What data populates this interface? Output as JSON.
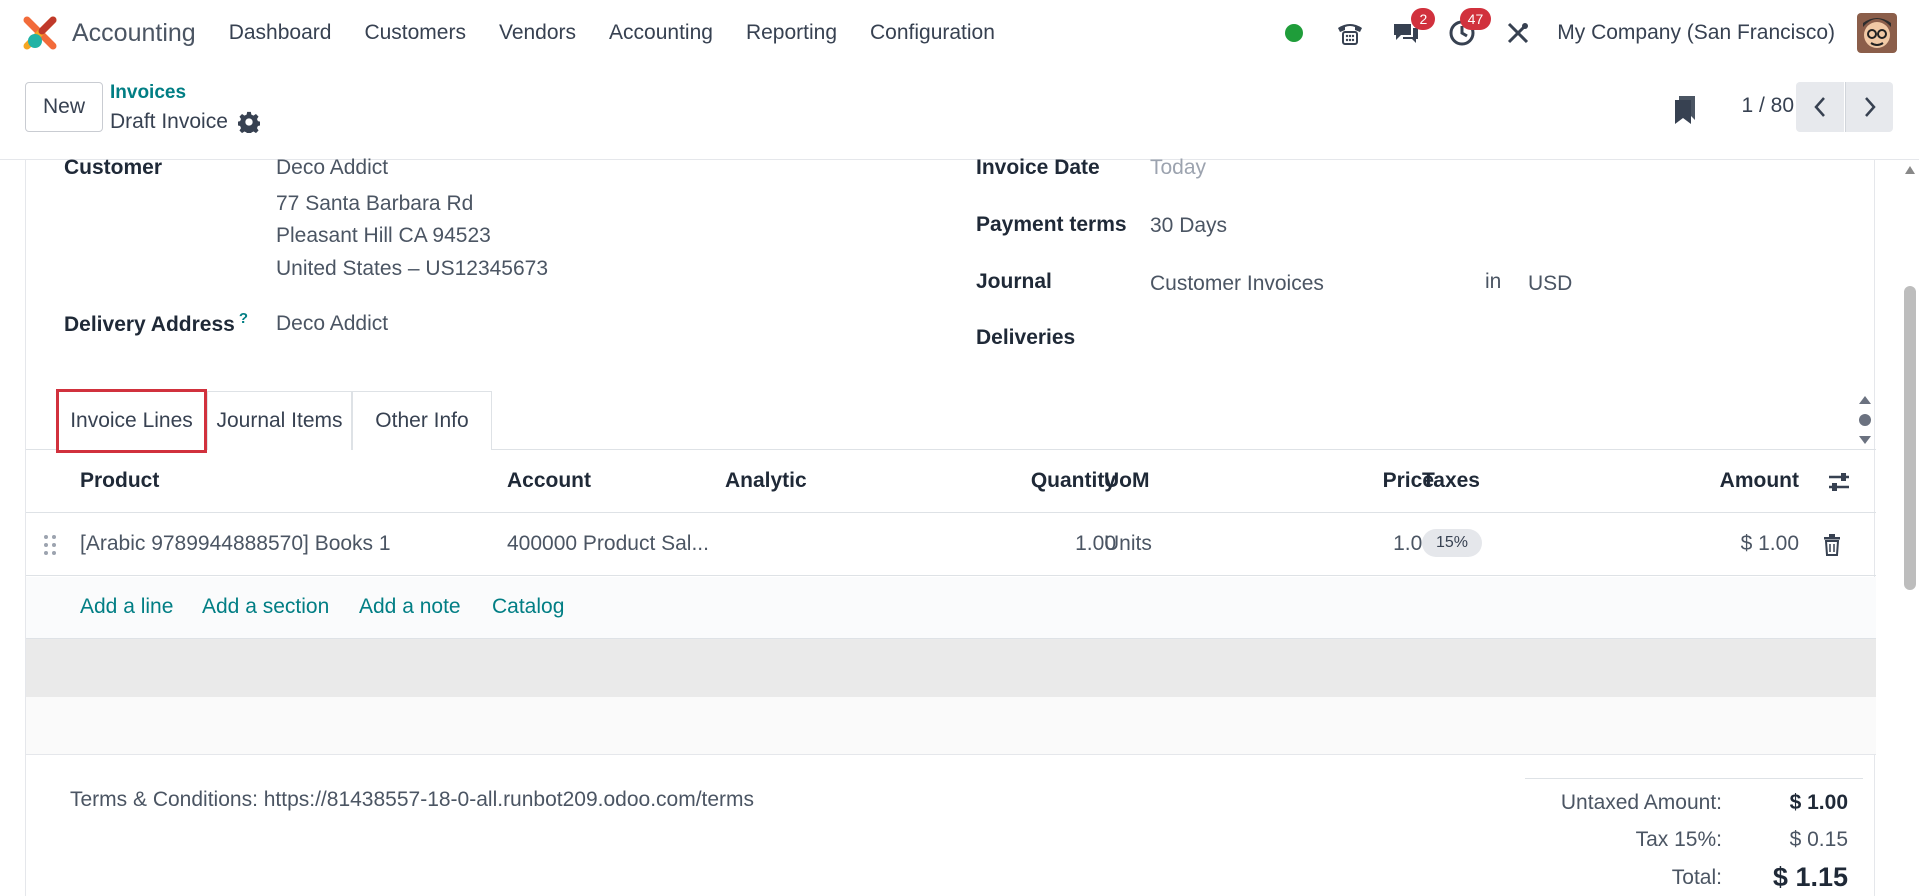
{
  "navbar": {
    "app_name": "Accounting",
    "menu": [
      "Dashboard",
      "Customers",
      "Vendors",
      "Accounting",
      "Reporting",
      "Configuration"
    ],
    "messages_badge": "2",
    "activities_badge": "47",
    "company": "My Company (San Francisco)",
    "status_color": "#28a745"
  },
  "control": {
    "new_label": "New",
    "breadcrumb_parent": "Invoices",
    "breadcrumb_current": "Draft Invoice",
    "pager": "1 / 80"
  },
  "form": {
    "customer_label": "Customer",
    "customer_name": "Deco Addict",
    "address_line1": "77 Santa Barbara Rd",
    "address_line2": "Pleasant Hill CA 94523",
    "address_line3": "United States – US12345673",
    "delivery_label": "Delivery Address",
    "delivery_help": "?",
    "delivery_value": "Deco Addict",
    "invoice_date_label": "Invoice Date",
    "invoice_date_value": "Today",
    "payment_terms_label": "Payment terms",
    "payment_terms_value": "30 Days",
    "journal_label": "Journal",
    "journal_value": "Customer Invoices",
    "journal_in": "in",
    "currency": "USD",
    "deliveries_label": "Deliveries"
  },
  "tabs": [
    "Invoice Lines",
    "Journal Items",
    "Other Info"
  ],
  "table": {
    "headers": {
      "product": "Product",
      "account": "Account",
      "analytic": "Analytic",
      "quantity": "Quantity",
      "uom": "UoM",
      "price": "Price",
      "taxes": "Taxes",
      "amount": "Amount"
    },
    "rows": [
      {
        "product": "[Arabic 9789944888570] Books 1",
        "account": "400000 Product Sal...",
        "analytic": "",
        "quantity": "1.00",
        "uom": "Units",
        "price": "1.00",
        "taxes": "15%",
        "amount": "$ 1.00"
      }
    ],
    "actions": [
      "Add a line",
      "Add a section",
      "Add a note",
      "Catalog"
    ]
  },
  "footer": {
    "terms": "Terms & Conditions: https://81438557-18-0-all.runbot209.odoo.com/terms",
    "untaxed_label": "Untaxed Amount:",
    "untaxed_value": "$ 1.00",
    "tax_label": "Tax 15%:",
    "tax_value": "$ 0.15",
    "total_label": "Total:",
    "total_value": "$ 1.15"
  },
  "colors": {
    "accent": "#017e84",
    "highlight": "#d1313d"
  }
}
